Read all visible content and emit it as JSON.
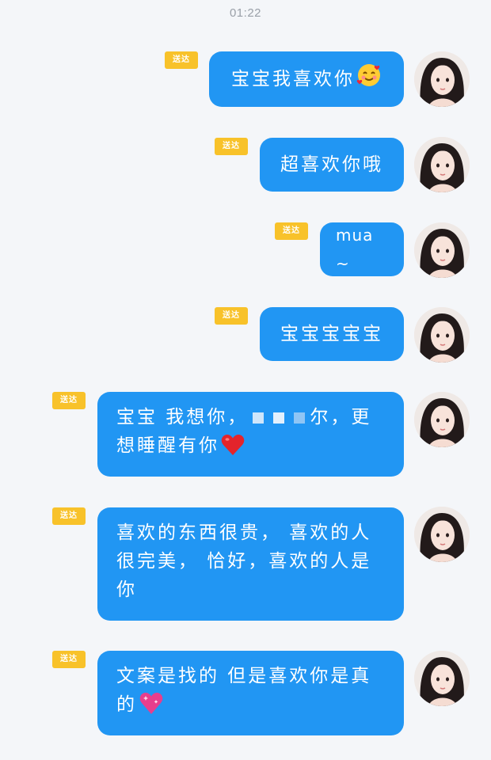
{
  "status": {
    "time": "01:22"
  },
  "badge_label": "送达",
  "messages": [
    {
      "text": "宝宝我喜欢你",
      "emoji": "smiling-face-with-hearts-emoji"
    },
    {
      "text": "超喜欢你哦"
    },
    {
      "text": "mua ~"
    },
    {
      "text": "宝宝宝宝宝"
    },
    {
      "text_before": "宝宝 我想你，",
      "text_after": "尔，更想睡醒有你",
      "emoji": "red-heart-emoji"
    },
    {
      "text": "喜欢的东西很贵， 喜欢的人很完美， 恰好，喜欢的人是你"
    },
    {
      "text": "文案是找的 但是喜欢你是真的",
      "emoji": "sparkling-heart-emoji"
    }
  ],
  "colors": {
    "bubble": "#2196f3",
    "badge": "#f8c22a",
    "background": "#f4f6f9"
  }
}
